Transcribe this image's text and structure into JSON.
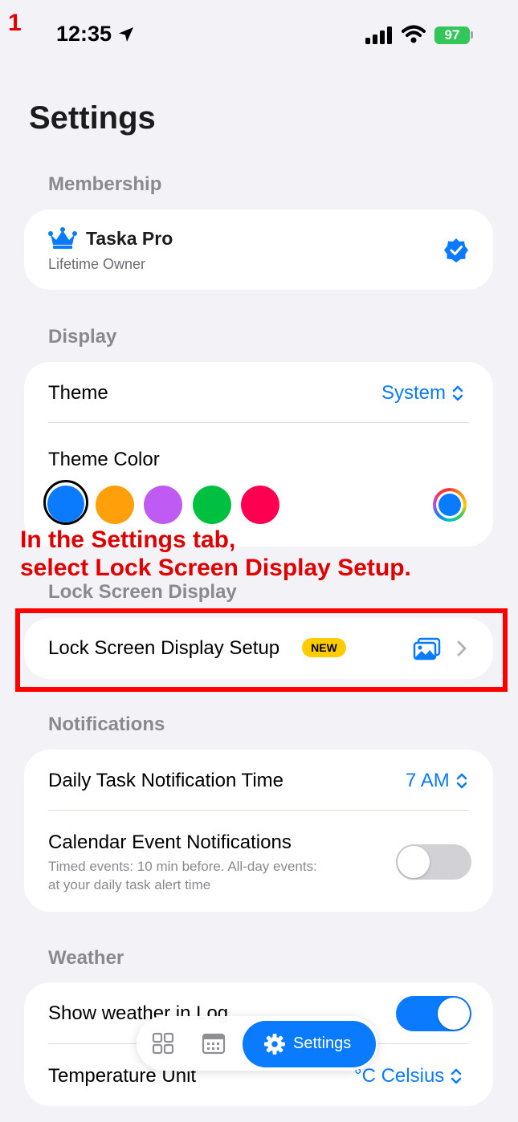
{
  "annotation": {
    "step_number": "1",
    "instruction_line1": "In the Settings tab,",
    "instruction_line2": "select Lock Screen Display Setup."
  },
  "status_bar": {
    "time": "12:35",
    "battery": "97"
  },
  "page": {
    "title": "Settings"
  },
  "membership": {
    "header": "Membership",
    "plan": "Taska Pro",
    "subtitle": "Lifetime Owner"
  },
  "display": {
    "header": "Display",
    "theme_label": "Theme",
    "theme_value": "System",
    "theme_color_label": "Theme Color",
    "colors": [
      "#0a7aff",
      "#ff9f0a",
      "#bf5af2",
      "#00c040",
      "#ff0050"
    ],
    "selected_color": "#0a7aff"
  },
  "lock_screen": {
    "header": "Lock Screen Display",
    "setup_label": "Lock Screen Display Setup",
    "badge": "NEW"
  },
  "notifications": {
    "header": "Notifications",
    "daily_label": "Daily Task Notification Time",
    "daily_value": "7 AM",
    "calendar_label": "Calendar Event Notifications",
    "calendar_desc_line1": "Timed events: 10 min before. All-day events:",
    "calendar_desc_line2": "at your daily task alert time",
    "calendar_enabled": false
  },
  "weather": {
    "header": "Weather",
    "show_label": "Show weather in Log",
    "show_enabled": true,
    "unit_label": "Temperature Unit",
    "unit_value": "°C Celsius"
  },
  "tab_bar": {
    "settings_label": "Settings"
  },
  "colors": {
    "accent": "#0a7aff",
    "annotation": "#e00000",
    "badge": "#ffcc00",
    "battery": "#33c759"
  }
}
